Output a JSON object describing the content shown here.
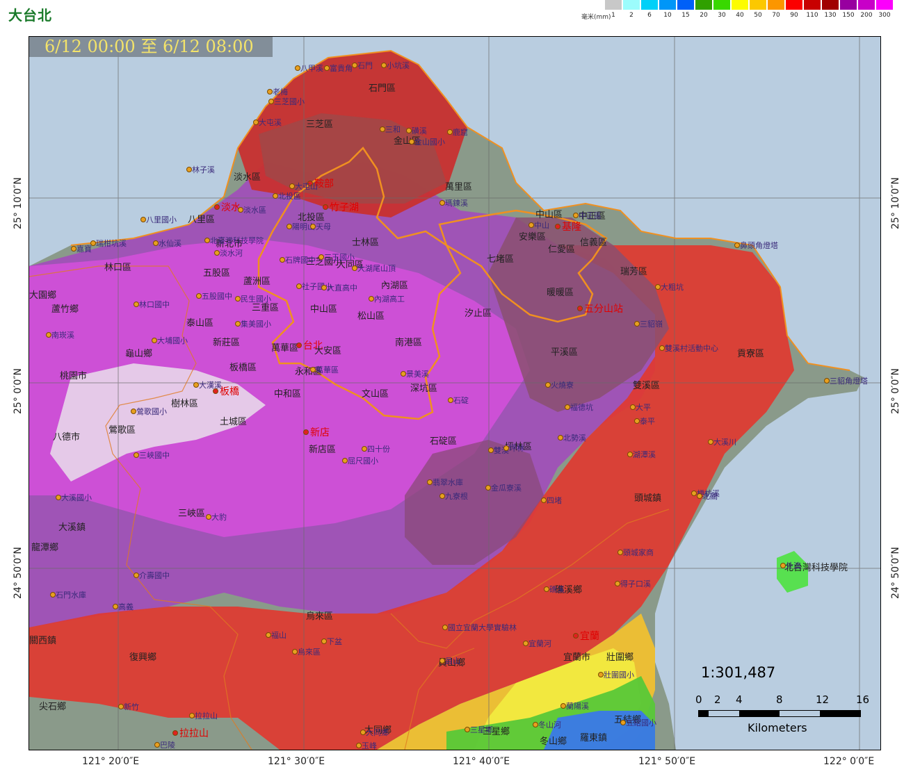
{
  "brand": "大台北",
  "time_range": "6/12 00:00 至 6/12 08:00",
  "legend": {
    "unit": "毫米(mm)",
    "bins": [
      {
        "label": "1",
        "color": "#c8c8c8"
      },
      {
        "label": "2",
        "color": "#9cfcfc"
      },
      {
        "label": "6",
        "color": "#00d0f8"
      },
      {
        "label": "10",
        "color": "#0096f8"
      },
      {
        "label": "15",
        "color": "#0060f8"
      },
      {
        "label": "20",
        "color": "#30a000"
      },
      {
        "label": "30",
        "color": "#38d800"
      },
      {
        "label": "40",
        "color": "#fcfc00"
      },
      {
        "label": "50",
        "color": "#fcc800"
      },
      {
        "label": "70",
        "color": "#fc9600"
      },
      {
        "label": "90",
        "color": "#fc0000"
      },
      {
        "label": "110",
        "color": "#c80000"
      },
      {
        "label": "130",
        "color": "#a00000"
      },
      {
        "label": "150",
        "color": "#9800a0"
      },
      {
        "label": "200",
        "color": "#c800c8"
      },
      {
        "label": "300",
        "color": "#fc00fc"
      }
    ]
  },
  "axes": {
    "lon": [
      "121° 20′0″E",
      "121° 30′0″E",
      "121° 40′0″E",
      "121° 50′0″E",
      "122° 0′0″E"
    ],
    "lat": [
      "25° 10′0″N",
      "25° 0′0″N",
      "24° 50′0″N"
    ]
  },
  "scale": {
    "ratio": "1:301,487",
    "ticks": [
      "0",
      "2",
      "4",
      "8",
      "12",
      "16"
    ],
    "unit": "Kilometers"
  },
  "places": {
    "red": [
      "基隆",
      "竹子湖",
      "鞍部",
      "淡水",
      "五分山站",
      "台北",
      "板橋",
      "新店",
      "宜蘭",
      "拉拉山"
    ],
    "black": [
      "淡水區",
      "三芝區",
      "石門區",
      "金山區",
      "萬里區",
      "北投區",
      "士林區",
      "中山區",
      "中正區",
      "信義區",
      "仁愛區",
      "安樂區",
      "七堵區",
      "暖暖區",
      "瑞芳區",
      "汐止區",
      "內湖區",
      "南港區",
      "松山區",
      "大安區",
      "文山區",
      "深坑區",
      "石碇區",
      "平溪區",
      "雙溪區",
      "貢寮區",
      "八里區",
      "林口區",
      "五股區",
      "蘆洲區",
      "三重區",
      "泰山區",
      "新莊區",
      "樹林區",
      "土城區",
      "鶯歌區",
      "三峽區",
      "板橋區",
      "中和區",
      "永和區",
      "萬華區",
      "新店區",
      "坪林區",
      "頭城鎮",
      "礁溪鄉",
      "宜蘭市",
      "壯圍鄉",
      "員山鄉",
      "三星鄉",
      "五結鄉",
      "冬山鄉",
      "羅東鎮",
      "大同鄉",
      "烏來區",
      "復興鄉",
      "龍潭鄉",
      "大溪鎮",
      "八德市",
      "桃園市",
      "龜山鄉",
      "蘆竹鄉",
      "大園鄉",
      "關西鎮",
      "尖石鄉",
      "三芝國小",
      "中山區",
      "大同區",
      "新北市",
      "北台灣科技學院",
      "龜山島"
    ]
  },
  "stations": [
    "八甲溪",
    "富貴角",
    "石門",
    "小坑溪",
    "老梅",
    "三芝國小",
    "大屯溪",
    "三和",
    "磺溪",
    "金山國小",
    "鹿窟",
    "林子溪",
    "淡水區",
    "北投區",
    "大屯山",
    "陽明山",
    "天母",
    "瑪鍊溪",
    "中山",
    "中正區",
    "嘉寶",
    "瑞柑坑溪",
    "八里國小",
    "水仙溪",
    "淡水河",
    "北臺灣科技學院",
    "石牌國中",
    "三玉國小",
    "大湖尾山頂",
    "社子國小",
    "大直高中",
    "內湖高工",
    "五股國中",
    "民生國小",
    "集美國小",
    "林口國中",
    "南崁溪",
    "大埔國小",
    "萬華區",
    "景美溪",
    "大漢溪",
    "鶯歌國小",
    "三峽國中",
    "四十份",
    "屈尺國小",
    "翡翠水庫",
    "九寮根",
    "金瓜寮溪",
    "福德坑",
    "大豹",
    "大溪國小",
    "介壽國中",
    "石門水庫",
    "高義",
    "福山",
    "下盆",
    "員山",
    "烏來區",
    "新竹",
    "拉拉山",
    "巴陵",
    "玉峰",
    "大同鄉",
    "三星鄉",
    "雙溪村活動中心",
    "三貂角燈塔",
    "鼻頭角燈塔",
    "大粗坑",
    "三貂嶺",
    "頭城家商",
    "得子口溪",
    "國立宜蘭大學實驗林",
    "宜蘭河",
    "壯圍國小",
    "蘭陽溪",
    "冬山河",
    "五結國小",
    "北勢溪",
    "大溪川",
    "湖潭溪",
    "梗枋溪",
    "北關",
    "四堵",
    "雙溪",
    "泰平",
    "大平",
    "火燒寮",
    "石碇",
    "坪林",
    "礁溪",
    "外澳",
    "龜山"
  ]
}
